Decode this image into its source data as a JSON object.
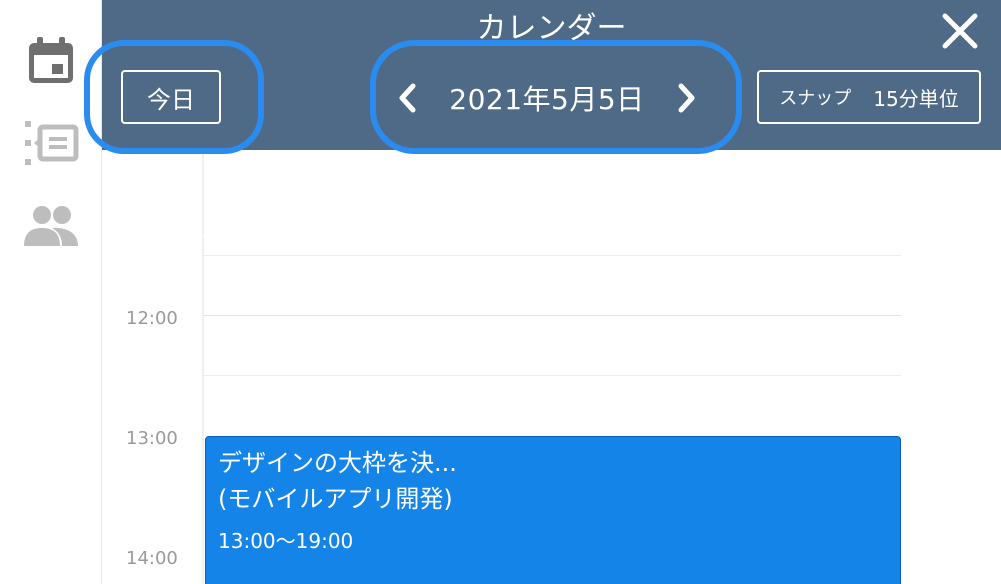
{
  "header": {
    "title": "カレンダー",
    "today_label": "今日",
    "date_label": "2021年5月5日",
    "snap_label": "スナップ",
    "snap_value": "15分単位"
  },
  "sidebar": {
    "items": [
      {
        "icon": "calendar-icon",
        "color": "#6f6f6f"
      },
      {
        "icon": "list-icon",
        "color": "#bdbdbd"
      },
      {
        "icon": "people-icon",
        "color": "#bdbdbd"
      }
    ]
  },
  "timeline": {
    "labels": [
      "12:00",
      "13:00",
      "14:00"
    ]
  },
  "event": {
    "title": "デザインの大枠を決...",
    "project": "(モバイルアプリ開発)",
    "time": "13:00〜19:00",
    "color": "#1584e8"
  },
  "colors": {
    "header": "#4f6a86",
    "highlight": "#2b8cf0"
  }
}
